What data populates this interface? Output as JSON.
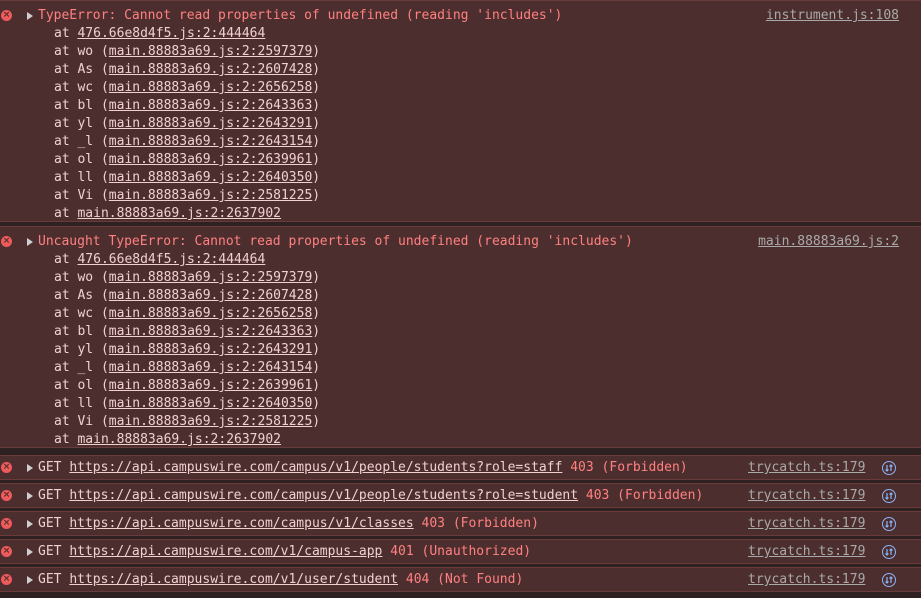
{
  "errors": [
    {
      "message": "TypeError: Cannot read properties of undefined (reading 'includes')",
      "source": "instrument.js:108",
      "frames": [
        {
          "fn": "",
          "loc": "476.66e8d4f5.js:2:444464"
        },
        {
          "fn": "wo",
          "loc": "main.88883a69.js:2:2597379"
        },
        {
          "fn": "As",
          "loc": "main.88883a69.js:2:2607428"
        },
        {
          "fn": "wc",
          "loc": "main.88883a69.js:2:2656258"
        },
        {
          "fn": "bl",
          "loc": "main.88883a69.js:2:2643363"
        },
        {
          "fn": "yl",
          "loc": "main.88883a69.js:2:2643291"
        },
        {
          "fn": "_l",
          "loc": "main.88883a69.js:2:2643154"
        },
        {
          "fn": "ol",
          "loc": "main.88883a69.js:2:2639961"
        },
        {
          "fn": "ll",
          "loc": "main.88883a69.js:2:2640350"
        },
        {
          "fn": "Vi",
          "loc": "main.88883a69.js:2:2581225"
        },
        {
          "fn": "",
          "loc": "main.88883a69.js:2:2637902"
        }
      ]
    },
    {
      "message": "Uncaught TypeError: Cannot read properties of undefined (reading 'includes')",
      "source": "main.88883a69.js:2",
      "frames": [
        {
          "fn": "",
          "loc": "476.66e8d4f5.js:2:444464"
        },
        {
          "fn": "wo",
          "loc": "main.88883a69.js:2:2597379"
        },
        {
          "fn": "As",
          "loc": "main.88883a69.js:2:2607428"
        },
        {
          "fn": "wc",
          "loc": "main.88883a69.js:2:2656258"
        },
        {
          "fn": "bl",
          "loc": "main.88883a69.js:2:2643363"
        },
        {
          "fn": "yl",
          "loc": "main.88883a69.js:2:2643291"
        },
        {
          "fn": "_l",
          "loc": "main.88883a69.js:2:2643154"
        },
        {
          "fn": "ol",
          "loc": "main.88883a69.js:2:2639961"
        },
        {
          "fn": "ll",
          "loc": "main.88883a69.js:2:2640350"
        },
        {
          "fn": "Vi",
          "loc": "main.88883a69.js:2:2581225"
        },
        {
          "fn": "",
          "loc": "main.88883a69.js:2:2637902"
        }
      ]
    }
  ],
  "at_label": "at",
  "requests": [
    {
      "method": "GET",
      "url": "https://api.campuswire.com/campus/v1/people/students?role=staff",
      "status": "403 (Forbidden)",
      "source": "trycatch.ts:179"
    },
    {
      "method": "GET",
      "url": "https://api.campuswire.com/campus/v1/people/students?role=student",
      "status": "403 (Forbidden)",
      "source": "trycatch.ts:179"
    },
    {
      "method": "GET",
      "url": "https://api.campuswire.com/campus/v1/classes",
      "status": "403 (Forbidden)",
      "source": "trycatch.ts:179"
    },
    {
      "method": "GET",
      "url": "https://api.campuswire.com/v1/campus-app",
      "status": "401 (Unauthorized)",
      "source": "trycatch.ts:179"
    },
    {
      "method": "GET",
      "url": "https://api.campuswire.com/v1/user/student",
      "status": "404 (Not Found)",
      "source": "trycatch.ts:179"
    }
  ],
  "icons": {
    "error": "error-circle-icon",
    "expand": "expand-triangle-icon",
    "network": "network-request-icon"
  },
  "colors": {
    "background": "#4d2e2e",
    "error_text": "#ff8080",
    "link": "#f1d0d0",
    "source": "#a9a9a9",
    "icon": "#ef5b5b"
  }
}
